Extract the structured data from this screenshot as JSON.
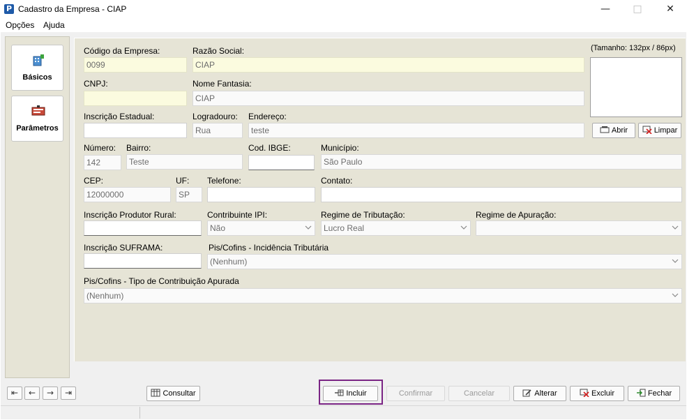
{
  "window": {
    "title": "Cadastro da Empresa - CIAP",
    "app_icon_letter": "P"
  },
  "menu": [
    "Opções",
    "Ajuda"
  ],
  "sidebar": [
    {
      "label": "Básicos",
      "icon": "building-icon"
    },
    {
      "label": "Parâmetros",
      "icon": "settings-panel-icon"
    }
  ],
  "image_panel": {
    "size_hint": "(Tamanho: 132px / 86px)",
    "open_label": "Abrir",
    "clear_label": "Limpar"
  },
  "form": {
    "codigo": {
      "label": "Código da Empresa:",
      "value": "0099"
    },
    "razao": {
      "label": "Razão Social:",
      "value": "CIAP"
    },
    "cnpj": {
      "label": "CNPJ:",
      "value": ""
    },
    "fantasia": {
      "label": "Nome Fantasia:",
      "value": "CIAP"
    },
    "ie": {
      "label": "Inscrição Estadual:",
      "value": ""
    },
    "logradouro": {
      "label": "Logradouro:",
      "value": "Rua"
    },
    "endereco": {
      "label": "Endereço:",
      "value": "teste"
    },
    "numero": {
      "label": "Número:",
      "value": "142"
    },
    "bairro": {
      "label": "Bairro:",
      "value": "Teste"
    },
    "ibge": {
      "label": "Cod. IBGE:",
      "value": ""
    },
    "municipio": {
      "label": "Município:",
      "value": "São Paulo"
    },
    "cep": {
      "label": "CEP:",
      "value": "12000000"
    },
    "uf": {
      "label": "UF:",
      "value": "SP"
    },
    "telefone": {
      "label": "Telefone:",
      "value": ""
    },
    "contato": {
      "label": "Contato:",
      "value": ""
    },
    "produtor": {
      "label": "Inscrição Produtor Rural:",
      "value": ""
    },
    "ipi": {
      "label": "Contribuinte IPI:",
      "value": "Não"
    },
    "regime_trib": {
      "label": "Regime de Tributação:",
      "value": "Lucro Real"
    },
    "regime_apur": {
      "label": "Regime de Apuração:",
      "value": ""
    },
    "suframa": {
      "label": "Inscrição SUFRAMA:",
      "value": ""
    },
    "pis_incid": {
      "label": "Pis/Cofins - Incidência Tributária",
      "value": "(Nenhum)"
    },
    "pis_tipo": {
      "label": "Pis/Cofins - Tipo de Contribuição Apurada",
      "value": "(Nenhum)"
    }
  },
  "toolbar": {
    "consultar": "Consultar",
    "incluir": "Incluir",
    "confirmar": "Confirmar",
    "cancelar": "Cancelar",
    "alterar": "Alterar",
    "excluir": "Excluir",
    "fechar": "Fechar"
  },
  "colors": {
    "panel": "#e6e4d6",
    "readonly_yellow": "#fbfbdf",
    "focus_frame": "#7a2484"
  }
}
